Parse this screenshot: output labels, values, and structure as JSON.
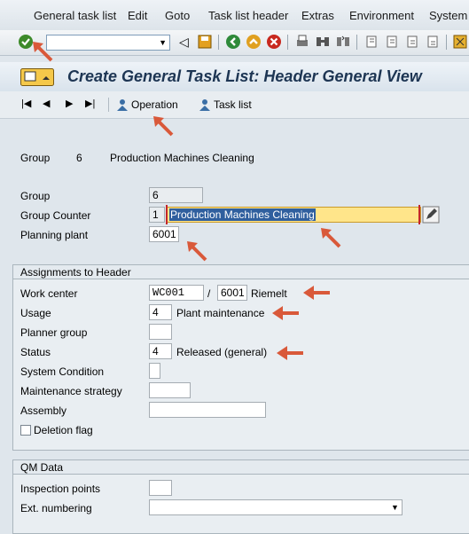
{
  "menubar": {
    "items": [
      "General task list",
      "Edit",
      "Goto",
      "Task list header",
      "Extras",
      "Environment",
      "System"
    ]
  },
  "toolbar": {
    "command_value": ""
  },
  "title": "Create General Task List: Header General View",
  "appbar": {
    "operation_label": "Operation",
    "tasklist_label": "Task list"
  },
  "summary": {
    "group_label": "Group",
    "group_value": "6",
    "description": "Production Machines Cleaning"
  },
  "header": {
    "group_label": "Group",
    "group_value": "6",
    "counter_label": "Group Counter",
    "counter_value": "1",
    "counter_text": "Production Machines Cleaning",
    "plant_label": "Planning plant",
    "plant_value": "6001"
  },
  "assignments": {
    "title": "Assignments to Header",
    "work_center_label": "Work center",
    "work_center_value": "WC001",
    "slash": "/",
    "work_center_plant": "6001",
    "work_center_text": "Riemelt",
    "usage_label": "Usage",
    "usage_value": "4",
    "usage_text": "Plant maintenance",
    "planner_label": "Planner group",
    "planner_value": "",
    "status_label": "Status",
    "status_value": "4",
    "status_text": "Released (general)",
    "syscond_label": "System Condition",
    "syscond_value": "",
    "strategy_label": "Maintenance strategy",
    "strategy_value": "",
    "assembly_label": "Assembly",
    "assembly_value": "",
    "deletion_label": "Deletion flag"
  },
  "qm": {
    "title": "QM Data",
    "inspection_label": "Inspection points",
    "inspection_value": "",
    "ext_label": "Ext. numbering",
    "ext_value": ""
  },
  "colors": {
    "arrow": "#d9593a",
    "highlight": "#ffe58a",
    "title": "#1d3553"
  }
}
